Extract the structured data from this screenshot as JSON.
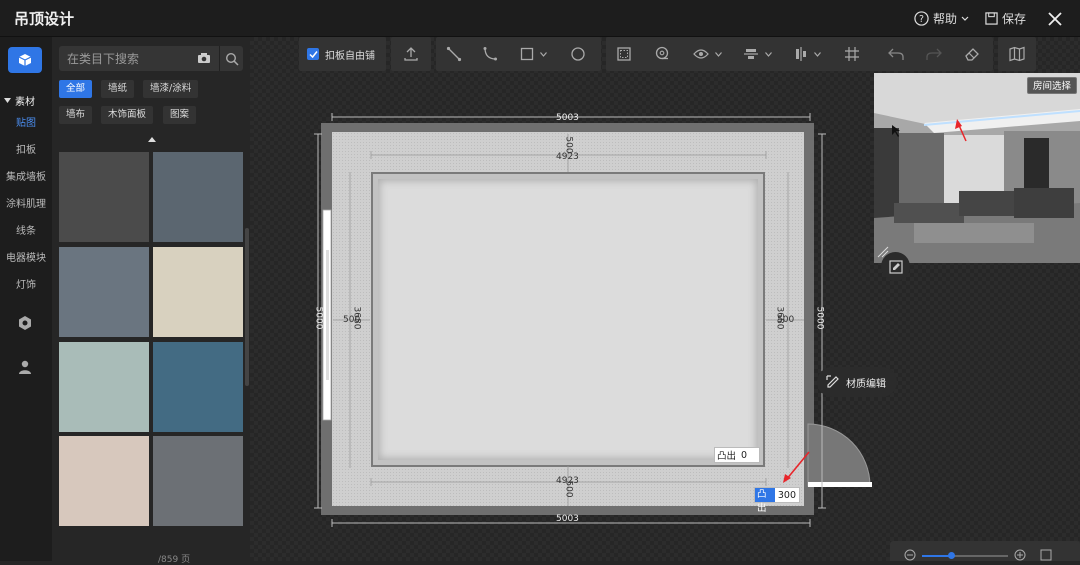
{
  "app": {
    "title": "吊顶设计"
  },
  "top_actions": {
    "help_label": "帮助",
    "save_label": "保存"
  },
  "leftrail": {
    "section_label": "素材",
    "items": [
      "贴图",
      "扣板",
      "集成墙板",
      "涂料肌理",
      "线条",
      "电器模块",
      "灯饰"
    ],
    "active_item": "贴图"
  },
  "panel": {
    "search_placeholder": "在类目下搜索",
    "chips": [
      "全部",
      "墙纸",
      "墙漆/涂料",
      "墙布",
      "木饰面板",
      "图案"
    ],
    "active_chip": "全部",
    "swatches": [
      "#4b4b4b",
      "#5b6670",
      "#6a7580",
      "#d8d1bf",
      "#a9bcb8",
      "#436b83",
      "#d7c8bd",
      "#6c7075"
    ],
    "footer_text": "/859 页"
  },
  "toolbar": {
    "free_board_label": "扣板自由铺",
    "free_board_checked": true
  },
  "plan": {
    "outer_width": "5003",
    "inner_width": "4923",
    "depth_label": "3680",
    "side_label": "5000",
    "offset_label": "500",
    "protrude_inner_label": "凸出",
    "protrude_inner_value": "0",
    "protrude_outer_label": "凸出",
    "protrude_outer_value": "300"
  },
  "preview": {
    "room_select_label": "房间选择"
  },
  "material_edit": {
    "label": "材质编辑"
  }
}
